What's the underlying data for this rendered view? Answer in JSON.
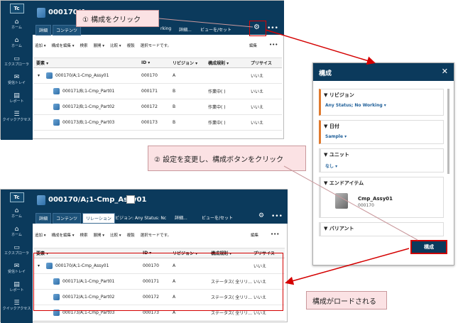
{
  "app": {
    "logo": "Tc",
    "rail_items": [
      {
        "label": "ホーム",
        "icon": "home-icon",
        "glyph": "⌂"
      },
      {
        "label": "ホーム",
        "icon": "home-alt-icon",
        "glyph": "⌂"
      },
      {
        "label": "エクスプローラ",
        "icon": "folder-icon",
        "glyph": "▭"
      },
      {
        "label": "受信トレイ",
        "icon": "inbox-icon",
        "glyph": "✉"
      },
      {
        "label": "レポート",
        "icon": "report-icon",
        "glyph": "▤"
      },
      {
        "label": "クイックアクセス",
        "icon": "quick-access-icon",
        "glyph": "☰"
      }
    ]
  },
  "top_window": {
    "title": "000170/A",
    "tabs": [
      "詳細",
      "コンテンツ"
    ],
    "header_misc": [
      "rking",
      "詳細..."
    ],
    "view_setting": "ビューを/セット",
    "toolbar": [
      "追加 ▾",
      "構成を編集 ▾",
      "検索",
      "展開 ▾",
      "比較 ▾",
      "複製",
      "選択モードです。",
      "編集",
      "•••"
    ],
    "columns": [
      "要素 ▾",
      "ID ▾",
      "リビジョン ▾",
      "構成規則 ▾",
      "プリサイス"
    ],
    "rows": [
      {
        "name": "000170/A;1-Cmp_Assy01",
        "id": "000170",
        "rev": "A",
        "rule": "",
        "precise": "いいえ"
      },
      {
        "name": "000171/B;1-Cmp_Part01",
        "id": "000171",
        "rev": "B",
        "rule": "作業中( )",
        "precise": "いいえ"
      },
      {
        "name": "000172/B;1-Cmp_Part02",
        "id": "000172",
        "rev": "B",
        "rule": "作業中( )",
        "precise": "いいえ"
      },
      {
        "name": "000173/B;1-Cmp_Part03",
        "id": "000173",
        "rev": "B",
        "rule": "作業中( )",
        "precise": "いいえ"
      }
    ]
  },
  "bottom_window": {
    "title": "000170/A;1-Cmp_Assy01",
    "tabs": [
      "詳細",
      "コンテンツ",
      "リレーション"
    ],
    "revision_rule": "リビジョン: Any Status: Nc",
    "header_misc": "詳細...",
    "view_setting": "ビューを/セット",
    "toolbar": [
      "追加 ▾",
      "構成を編集 ▾",
      "検索",
      "展開 ▾",
      "比較 ▾",
      "複製",
      "選択モードです。",
      "編集",
      "•••"
    ],
    "columns": [
      "要素 ▾",
      "ID ▾",
      "リビジョン ▾",
      "構成規則 ▾",
      "プリサイス"
    ],
    "rows": [
      {
        "name": "000170/A;1-Cmp_Assy01",
        "id": "000170",
        "rev": "A",
        "rule": "",
        "precise": "いいえ"
      },
      {
        "name": "000171/A;1-Cmp_Part01",
        "id": "000171",
        "rev": "A",
        "rule": "ステータス( 全リリ...",
        "precise": "いいえ"
      },
      {
        "name": "000172/A;1-Cmp_Part02",
        "id": "000172",
        "rev": "A",
        "rule": "ステータス( 全リリ...",
        "precise": "いいえ"
      },
      {
        "name": "000173/A;1-Cmp_Part03",
        "id": "000173",
        "rev": "A",
        "rule": "ステータス( 全リリ...",
        "precise": "いいえ"
      }
    ]
  },
  "config_panel": {
    "title": "構成",
    "close": "✕",
    "sections": [
      {
        "title": "▼ リビジョン",
        "value": "Any Status; No Working ▾"
      },
      {
        "title": "▼ 日付",
        "value": "Sample ▾"
      },
      {
        "title": "▼ ユニット",
        "value": "なし ▾"
      },
      {
        "title": "▼ エンドアイテム",
        "value": ""
      },
      {
        "title": "▼ バリアント",
        "value": ""
      }
    ],
    "end_item_name": "Cmp_Assy01",
    "end_item_id": "000170",
    "button": "構成"
  },
  "callouts": {
    "step1": "① 構成をクリック",
    "step2": "② 設定を変更し、構成ボタンをクリック",
    "result": "構成がロードされる"
  }
}
